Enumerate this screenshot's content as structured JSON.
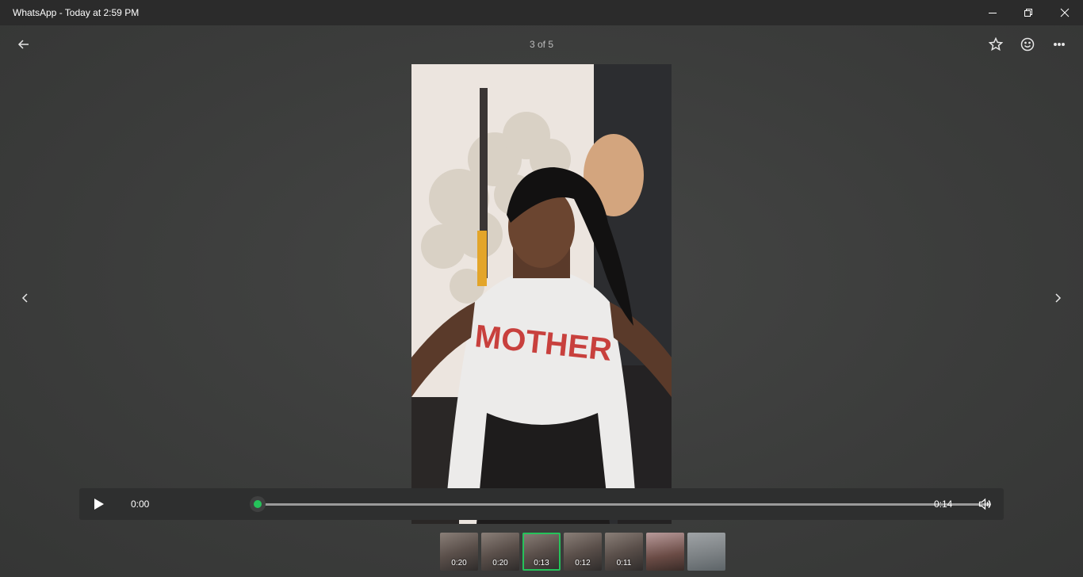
{
  "window": {
    "title": "WhatsApp - Today at 2:59 PM",
    "minimize_icon": "minimize-icon",
    "restore_icon": "restore-icon",
    "close_icon": "close-icon"
  },
  "viewer": {
    "counter": "3 of 5",
    "back_icon": "arrow-left-icon",
    "star_icon": "star-icon",
    "emoji_icon": "smiley-icon",
    "more_icon": "more-horizontal-icon",
    "prev_icon": "chevron-left-icon",
    "next_icon": "chevron-right-icon",
    "media_shirt_text": "MOTHER"
  },
  "player": {
    "play_icon": "play-icon",
    "current_time": "0:00",
    "duration": "0:14",
    "progress": 0,
    "volume_icon": "volume-icon",
    "accent_color": "#25c25a"
  },
  "thumbnails": [
    {
      "duration": "0:20",
      "selected": false
    },
    {
      "duration": "0:20",
      "selected": false
    },
    {
      "duration": "0:13",
      "selected": true
    },
    {
      "duration": "0:12",
      "selected": false
    },
    {
      "duration": "0:11",
      "selected": false
    },
    {
      "duration": "",
      "selected": false
    },
    {
      "duration": "",
      "selected": false
    }
  ]
}
